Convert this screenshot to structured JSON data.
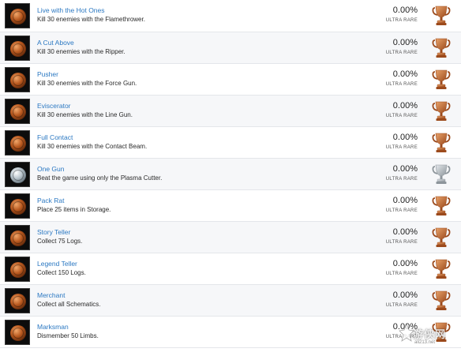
{
  "trophies": [
    {
      "title": "Live with the Hot Ones",
      "description": "Kill 30 enemies with the Flamethrower.",
      "percent": "0.00%",
      "rarity": "ULTRA RARE",
      "grade": "bronze"
    },
    {
      "title": "A Cut Above",
      "description": "Kill 30 enemies with the Ripper.",
      "percent": "0.00%",
      "rarity": "ULTRA RARE",
      "grade": "bronze"
    },
    {
      "title": "Pusher",
      "description": "Kill 30 enemies with the Force Gun.",
      "percent": "0.00%",
      "rarity": "ULTRA RARE",
      "grade": "bronze"
    },
    {
      "title": "Eviscerator",
      "description": "Kill 30 enemies with the Line Gun.",
      "percent": "0.00%",
      "rarity": "ULTRA RARE",
      "grade": "bronze"
    },
    {
      "title": "Full Contact",
      "description": "Kill 30 enemies with the Contact Beam.",
      "percent": "0.00%",
      "rarity": "ULTRA RARE",
      "grade": "bronze"
    },
    {
      "title": "One Gun",
      "description": "Beat the game using only the Plasma Cutter.",
      "percent": "0.00%",
      "rarity": "ULTRA RARE",
      "grade": "silver"
    },
    {
      "title": "Pack Rat",
      "description": "Place 25 items in Storage.",
      "percent": "0.00%",
      "rarity": "ULTRA RARE",
      "grade": "bronze"
    },
    {
      "title": "Story Teller",
      "description": "Collect 75 Logs.",
      "percent": "0.00%",
      "rarity": "ULTRA RARE",
      "grade": "bronze"
    },
    {
      "title": "Legend Teller",
      "description": "Collect 150 Logs.",
      "percent": "0.00%",
      "rarity": "ULTRA RARE",
      "grade": "bronze"
    },
    {
      "title": "Merchant",
      "description": "Collect all Schematics.",
      "percent": "0.00%",
      "rarity": "ULTRA RARE",
      "grade": "bronze"
    },
    {
      "title": "Marksman",
      "description": "Dismember 50 Limbs.",
      "percent": "0.00%",
      "rarity": "ULTRA RARE",
      "grade": "bronze"
    }
  ],
  "watermark": {
    "text": "游侠网",
    "subtext": "ali213.net"
  },
  "colors": {
    "bronze_light": "#e9a36b",
    "bronze_dark": "#9c4a1c",
    "silver_light": "#e4e8ec",
    "silver_dark": "#8d959b",
    "link": "#2b78c2"
  },
  "icons": {
    "trophy": "trophy-icon",
    "game_art": "trophy-art-icon"
  }
}
